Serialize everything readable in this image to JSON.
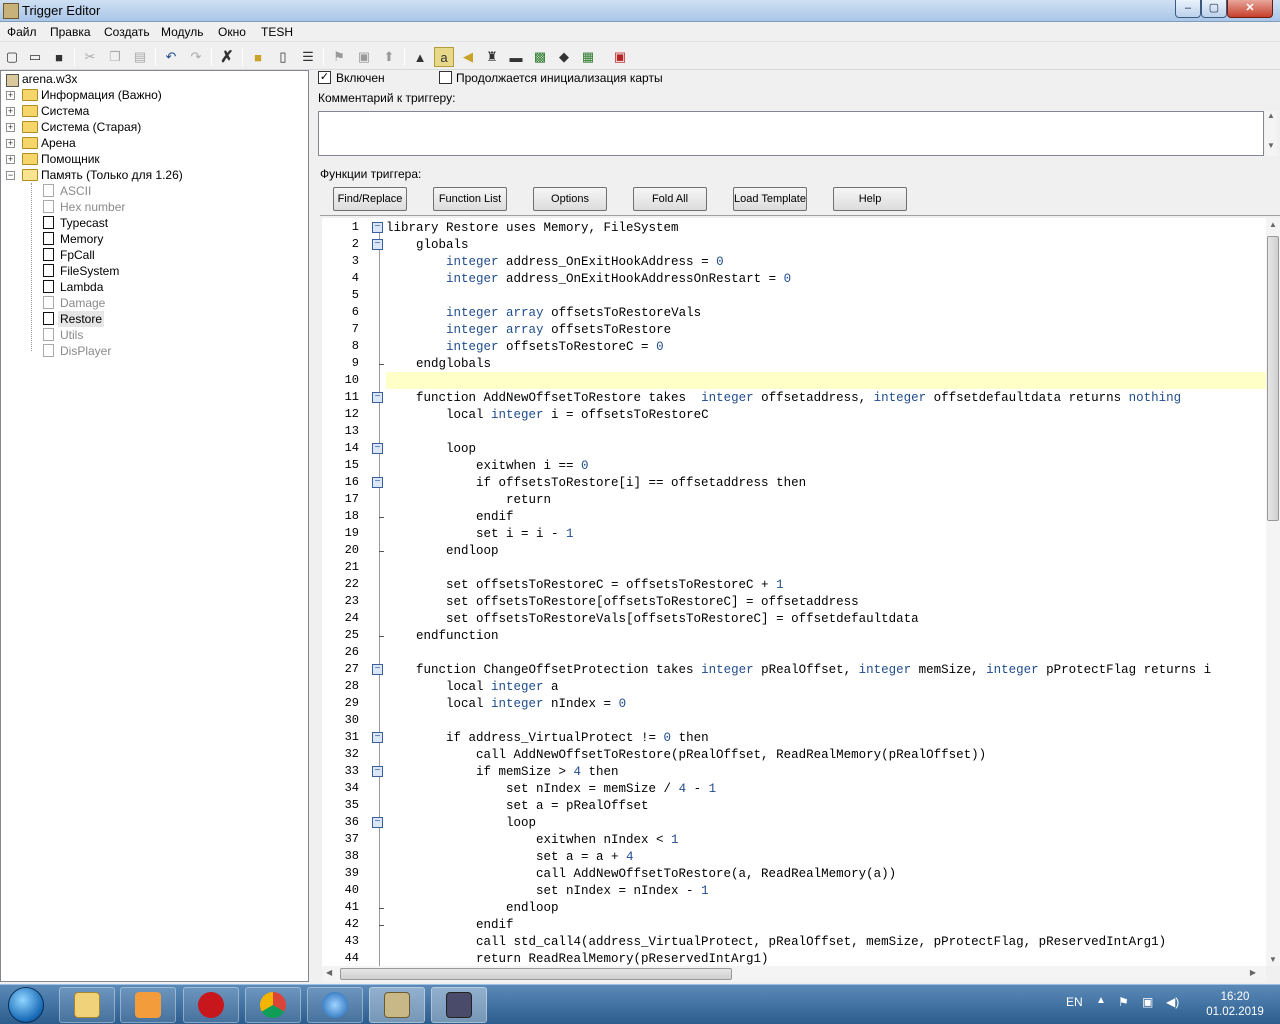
{
  "window": {
    "title": "Trigger Editor",
    "min": "‒",
    "max": "▢",
    "close": "✕"
  },
  "menu": [
    "Файл",
    "Правка",
    "Создать",
    "Модуль",
    "Окно",
    "TESH"
  ],
  "toolbar_icons": [
    "new-icon",
    "open-icon",
    "save-icon",
    "cut-icon",
    "copy-icon",
    "paste-icon",
    "undo-icon",
    "redo-icon",
    "delete-icon",
    "new-category-icon",
    "new-trigger-icon",
    "new-comment-icon",
    "test-map-icon",
    "variables-icon",
    "import-icon",
    "terrain-icon",
    "trigger-editor-icon",
    "sound-icon",
    "object-icon",
    "campaign-icon",
    "ai-icon",
    "script-icon",
    "module-icon",
    "tool-icon"
  ],
  "tree": {
    "root": "arena.w3x",
    "folders": [
      "Информация (Важно)",
      "Система",
      "Система (Старая)",
      "Арена",
      "Помощник",
      "Память (Только для 1.26)"
    ],
    "triggers": [
      {
        "label": "ASCII",
        "disabled": true
      },
      {
        "label": "Hex number",
        "disabled": true
      },
      {
        "label": "Typecast",
        "disabled": false
      },
      {
        "label": "Memory",
        "disabled": false
      },
      {
        "label": "FpCall",
        "disabled": false
      },
      {
        "label": "FileSystem",
        "disabled": false
      },
      {
        "label": "Lambda",
        "disabled": false
      },
      {
        "label": "Damage",
        "disabled": true
      },
      {
        "label": "Restore",
        "disabled": false,
        "selected": true
      },
      {
        "label": "Utils",
        "disabled": true
      },
      {
        "label": "DisPlayer",
        "disabled": true
      }
    ]
  },
  "trigger": {
    "enabled_label": "Включен",
    "enabled": true,
    "init_label": "Продолжается инициализация карты",
    "init": false,
    "comment_label": "Комментарий к триггеру:",
    "functions_label": "Функции триггера:"
  },
  "buttons": [
    "Find/Replace",
    "Function List",
    "Options",
    "Fold All",
    "Load Template",
    "Help"
  ],
  "code": [
    {
      "n": "1",
      "fold": true,
      "t": "library Restore uses Memory, FileSystem"
    },
    {
      "n": "2",
      "fold": true,
      "t": "    globals"
    },
    {
      "n": "3",
      "t": "        integer address_OnExitHookAddress = 0"
    },
    {
      "n": "4",
      "t": "        integer address_OnExitHookAddressOnRestart = 0"
    },
    {
      "n": "5",
      "t": ""
    },
    {
      "n": "6",
      "t": "        integer array offsetsToRestoreVals"
    },
    {
      "n": "7",
      "t": "        integer array offsetsToRestore"
    },
    {
      "n": "8",
      "t": "        integer offsetsToRestoreC = 0"
    },
    {
      "n": "9",
      "end": true,
      "t": "    endglobals"
    },
    {
      "n": "10",
      "hl": true,
      "t": ""
    },
    {
      "n": "11",
      "fold": true,
      "t": "    function AddNewOffsetToRestore takes  integer offsetaddress, integer offsetdefaultdata returns nothing"
    },
    {
      "n": "12",
      "t": "        local integer i = offsetsToRestoreC"
    },
    {
      "n": "13",
      "t": ""
    },
    {
      "n": "14",
      "fold": true,
      "t": "        loop"
    },
    {
      "n": "15",
      "t": "            exitwhen i == 0"
    },
    {
      "n": "16",
      "fold": true,
      "t": "            if offsetsToRestore[i] == offsetaddress then"
    },
    {
      "n": "17",
      "t": "                return"
    },
    {
      "n": "18",
      "end": true,
      "t": "            endif"
    },
    {
      "n": "19",
      "t": "            set i = i - 1"
    },
    {
      "n": "20",
      "end": true,
      "t": "        endloop"
    },
    {
      "n": "21",
      "t": ""
    },
    {
      "n": "22",
      "t": "        set offsetsToRestoreC = offsetsToRestoreC + 1"
    },
    {
      "n": "23",
      "t": "        set offsetsToRestore[offsetsToRestoreC] = offsetaddress"
    },
    {
      "n": "24",
      "t": "        set offsetsToRestoreVals[offsetsToRestoreC] = offsetdefaultdata"
    },
    {
      "n": "25",
      "end": true,
      "t": "    endfunction"
    },
    {
      "n": "26",
      "t": ""
    },
    {
      "n": "27",
      "fold": true,
      "t": "    function ChangeOffsetProtection takes integer pRealOffset, integer memSize, integer pProtectFlag returns i"
    },
    {
      "n": "28",
      "t": "        local integer a"
    },
    {
      "n": "29",
      "t": "        local integer nIndex = 0"
    },
    {
      "n": "30",
      "t": ""
    },
    {
      "n": "31",
      "fold": true,
      "t": "        if address_VirtualProtect != 0 then"
    },
    {
      "n": "32",
      "t": "            call AddNewOffsetToRestore(pRealOffset, ReadRealMemory(pRealOffset))"
    },
    {
      "n": "33",
      "fold": true,
      "t": "            if memSize > 4 then"
    },
    {
      "n": "34",
      "t": "                set nIndex = memSize / 4 - 1"
    },
    {
      "n": "35",
      "t": "                set a = pRealOffset"
    },
    {
      "n": "36",
      "fold": true,
      "t": "                loop"
    },
    {
      "n": "37",
      "t": "                    exitwhen nIndex < 1"
    },
    {
      "n": "38",
      "t": "                    set a = a + 4"
    },
    {
      "n": "39",
      "t": "                    call AddNewOffsetToRestore(a, ReadRealMemory(a))"
    },
    {
      "n": "40",
      "t": "                    set nIndex = nIndex - 1"
    },
    {
      "n": "41",
      "end": true,
      "t": "                endloop"
    },
    {
      "n": "42",
      "end": true,
      "t": "            endif"
    },
    {
      "n": "43",
      "t": "            call std_call4(address_VirtualProtect, pRealOffset, memSize, pProtectFlag, pReservedIntArg1)"
    },
    {
      "n": "44",
      "t": "            return ReadRealMemory(pReservedIntArg1)"
    }
  ],
  "taskbar": {
    "apps": [
      "start-button",
      "explorer-icon",
      "media-player-icon",
      "garena-icon",
      "chrome-icon",
      "mediaget-icon",
      "world-editor-icon",
      "warcraft-icon"
    ],
    "lang": "EN",
    "time": "16:20",
    "date": "01.02.2019"
  },
  "colors": {
    "keyword": "#000000",
    "type": "#1f4c8c",
    "number": "#1f4c8c",
    "current_line": "#ffffc8",
    "fold_marker": "#3a5fa0"
  }
}
